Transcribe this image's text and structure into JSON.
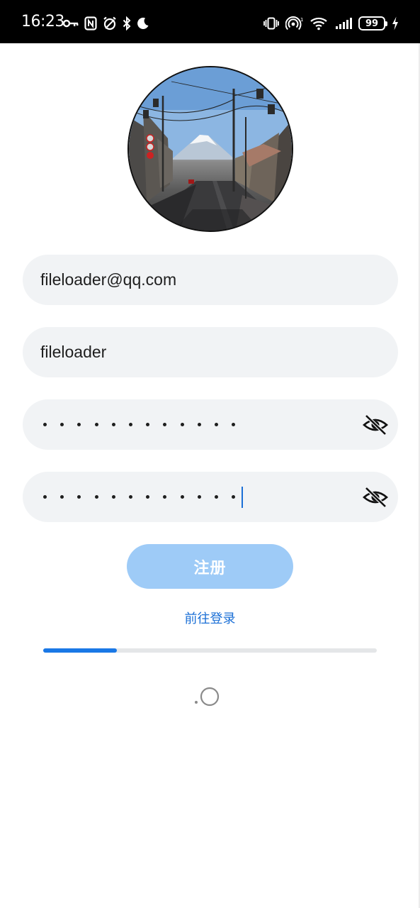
{
  "status_bar": {
    "time": "16:23",
    "battery_level": "99",
    "left_icons": [
      "key-icon",
      "nfc-icon",
      "alarm-icon",
      "bluetooth-icon",
      "moon-icon"
    ],
    "right_icons": [
      "vibrate-icon",
      "hotspot-icon",
      "wifi-icon",
      "signal-icon",
      "battery-icon",
      "charging-icon"
    ]
  },
  "avatar": {
    "description_icon": "avatar-photo"
  },
  "form": {
    "email_value": "fileloader@qq.com",
    "username_value": "fileloader",
    "password_mask_length": 12,
    "confirm_password_mask_length": 12,
    "toggle_icon": "eye-off-icon"
  },
  "actions": {
    "register_label": "注册",
    "login_link_label": "前往登录"
  },
  "progress": {
    "value_fraction": 0.22
  },
  "colors": {
    "accent": "#1a6fd6",
    "button_disabled": "#9ecbf7",
    "field_bg": "#f1f3f5"
  }
}
